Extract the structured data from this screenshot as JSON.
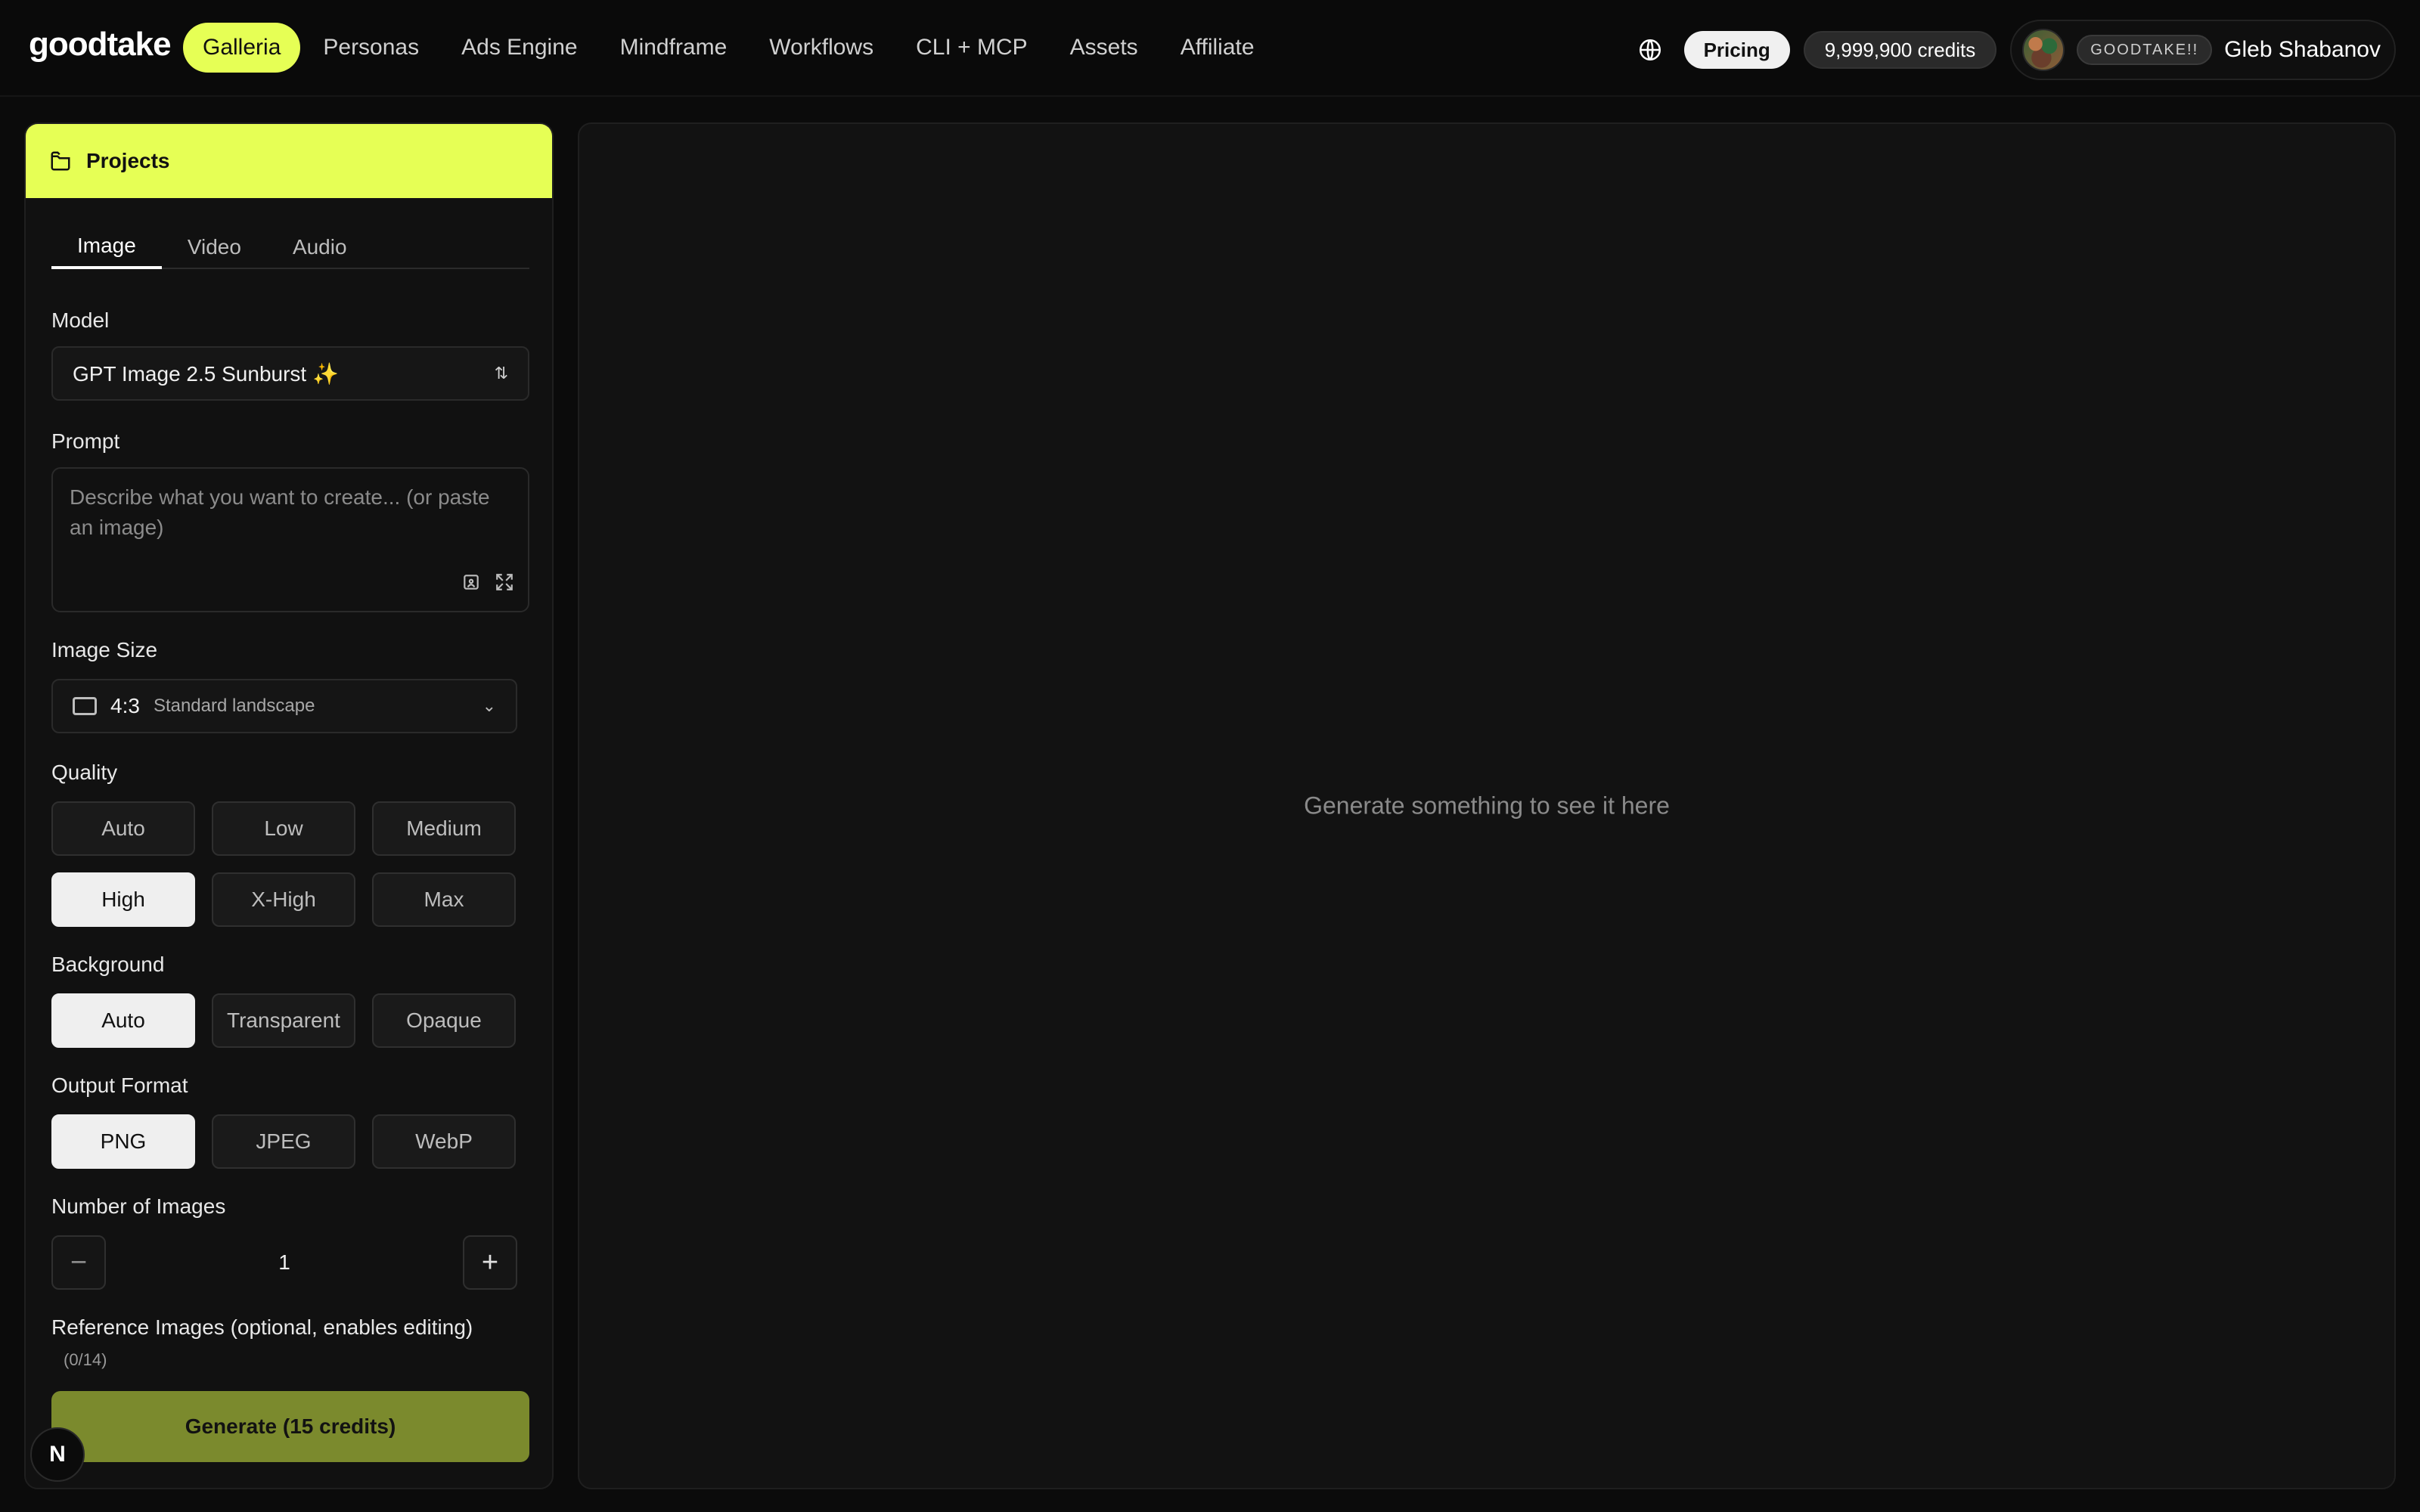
{
  "header": {
    "logo_text": "goodtake",
    "nav": [
      {
        "label": "Galleria",
        "active": true
      },
      {
        "label": "Personas",
        "active": false
      },
      {
        "label": "Ads Engine",
        "active": false
      },
      {
        "label": "Mindframe",
        "active": false
      },
      {
        "label": "Workflows",
        "active": false
      },
      {
        "label": "CLI + MCP",
        "active": false
      },
      {
        "label": "Assets",
        "active": false
      },
      {
        "label": "Affiliate",
        "active": false
      }
    ],
    "icons": {
      "globe": "globe-icon"
    },
    "pricing_label": "Pricing",
    "credits_label": "9,999,900 credits",
    "user": {
      "tag": "GOODTAKE!!",
      "name": "Gleb Shabanov"
    }
  },
  "left_panel": {
    "projects_title": "Projects",
    "tabs": [
      "Image",
      "Video",
      "Audio"
    ],
    "active_tab": "Image",
    "model": {
      "label": "Model",
      "value": "GPT Image 2.5 Sunburst ✨"
    },
    "prompt": {
      "label": "Prompt",
      "placeholder": "Describe what you want to create... (or paste an image)"
    },
    "image_size": {
      "label": "Image Size",
      "ratio": "4:3",
      "description": "Standard landscape"
    },
    "quality": {
      "label": "Quality",
      "options": [
        "Auto",
        "Low",
        "Medium",
        "High",
        "X-High",
        "Max"
      ],
      "selected": "High"
    },
    "background": {
      "label": "Background",
      "options": [
        "Auto",
        "Transparent",
        "Opaque"
      ],
      "selected": "Auto"
    },
    "output_format": {
      "label": "Output Format",
      "options": [
        "PNG",
        "JPEG",
        "WebP"
      ],
      "selected": "PNG"
    },
    "number_of_images": {
      "label": "Number of Images",
      "value": "1"
    },
    "reference_images": {
      "label": "Reference Images (optional, enables editing)",
      "count": "(0/14)"
    },
    "generate_label": "Generate (15 credits)",
    "badge_letter": "N"
  },
  "right_panel": {
    "empty_text": "Generate something to see it here"
  },
  "colors": {
    "accent": "#e6ff55",
    "accent_dark": "#7b8a2d",
    "background": "#0b0b0b"
  }
}
